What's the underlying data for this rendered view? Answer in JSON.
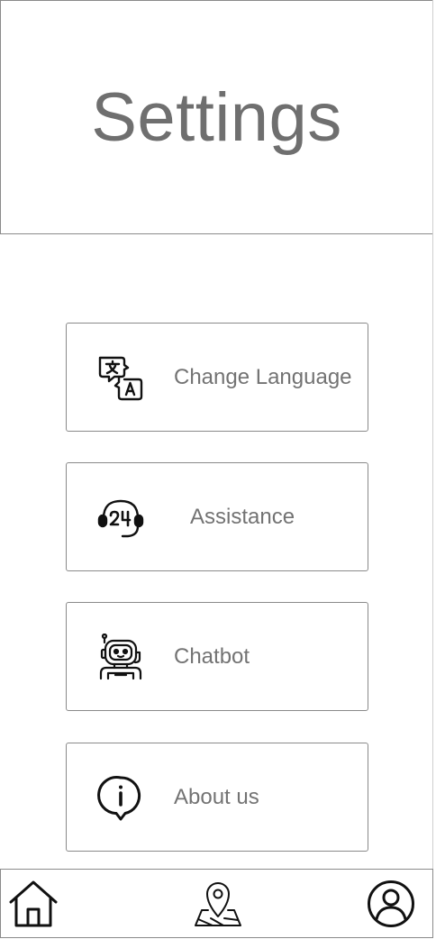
{
  "header": {
    "title": "Settings"
  },
  "menu": {
    "items": [
      {
        "label": "Change Language",
        "icon": "translate-icon"
      },
      {
        "label": "Assistance",
        "icon": "headset-24-icon"
      },
      {
        "label": "Chatbot",
        "icon": "robot-icon"
      },
      {
        "label": "About us",
        "icon": "info-bubble-icon"
      }
    ]
  },
  "bottom_nav": {
    "items": [
      {
        "icon": "home-icon"
      },
      {
        "icon": "map-pin-icon"
      },
      {
        "icon": "user-profile-icon"
      }
    ]
  },
  "colors": {
    "title_text": "#6f6f6f",
    "label_text": "#737373",
    "border": "#8a8a8a",
    "icon": "#111111"
  }
}
